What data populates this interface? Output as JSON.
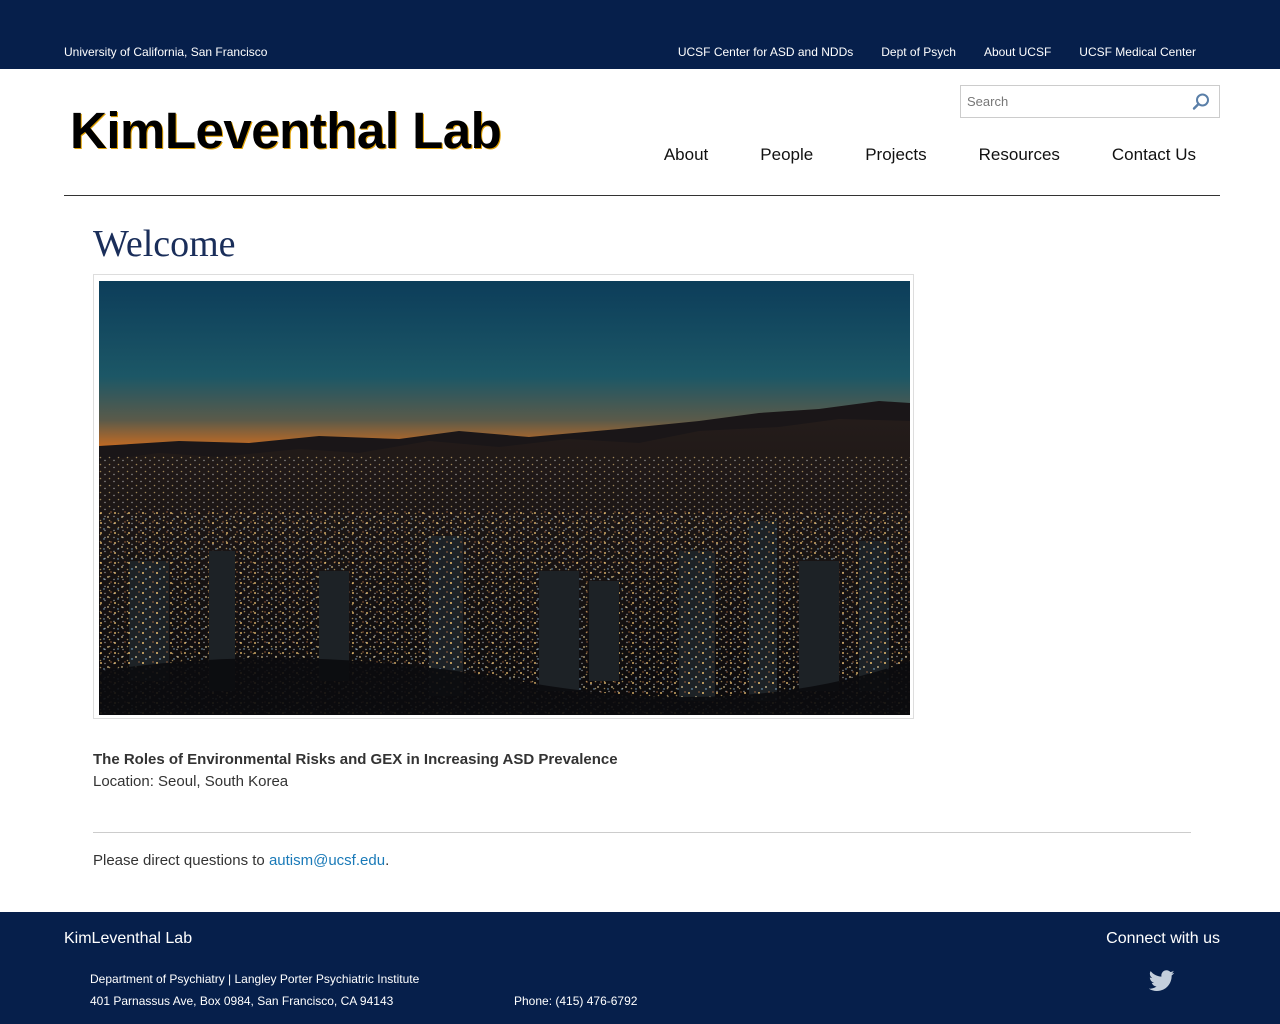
{
  "topbar": {
    "university": "University of California, San Francisco",
    "links": [
      "UCSF Center for ASD and NDDs",
      "Dept of Psych",
      "About UCSF",
      "UCSF Medical Center"
    ]
  },
  "header": {
    "logo": "KimLeventhal Lab",
    "search_placeholder": "Search",
    "search_icon": "magnifier-icon",
    "nav": [
      "About",
      "People",
      "Projects",
      "Resources",
      "Contact Us"
    ]
  },
  "main": {
    "title": "Welcome",
    "image_alt": "Night skyline of Seoul, South Korea",
    "caption_title": "The Roles of Environmental Risks and GEX in Increasing ASD Prevalence",
    "caption_location": "Location: Seoul, South Korea",
    "contact_prefix": "Please direct questions to ",
    "contact_email": "autism@ucsf.edu",
    "contact_suffix": "."
  },
  "footer": {
    "lab_name": "KimLeventhal Lab",
    "connect": "Connect with us",
    "department": "Department of Psychiatry | Langley Porter Psychiatric Institute",
    "address": "401 Parnassus Ave, Box 0984, San Francisco, CA 94143",
    "phone": "Phone: (415) 476-6792",
    "social_icon": "twitter-icon"
  },
  "colors": {
    "navy": "#061f4b",
    "link": "#1a7ab8",
    "heading": "#1a2e5a"
  }
}
